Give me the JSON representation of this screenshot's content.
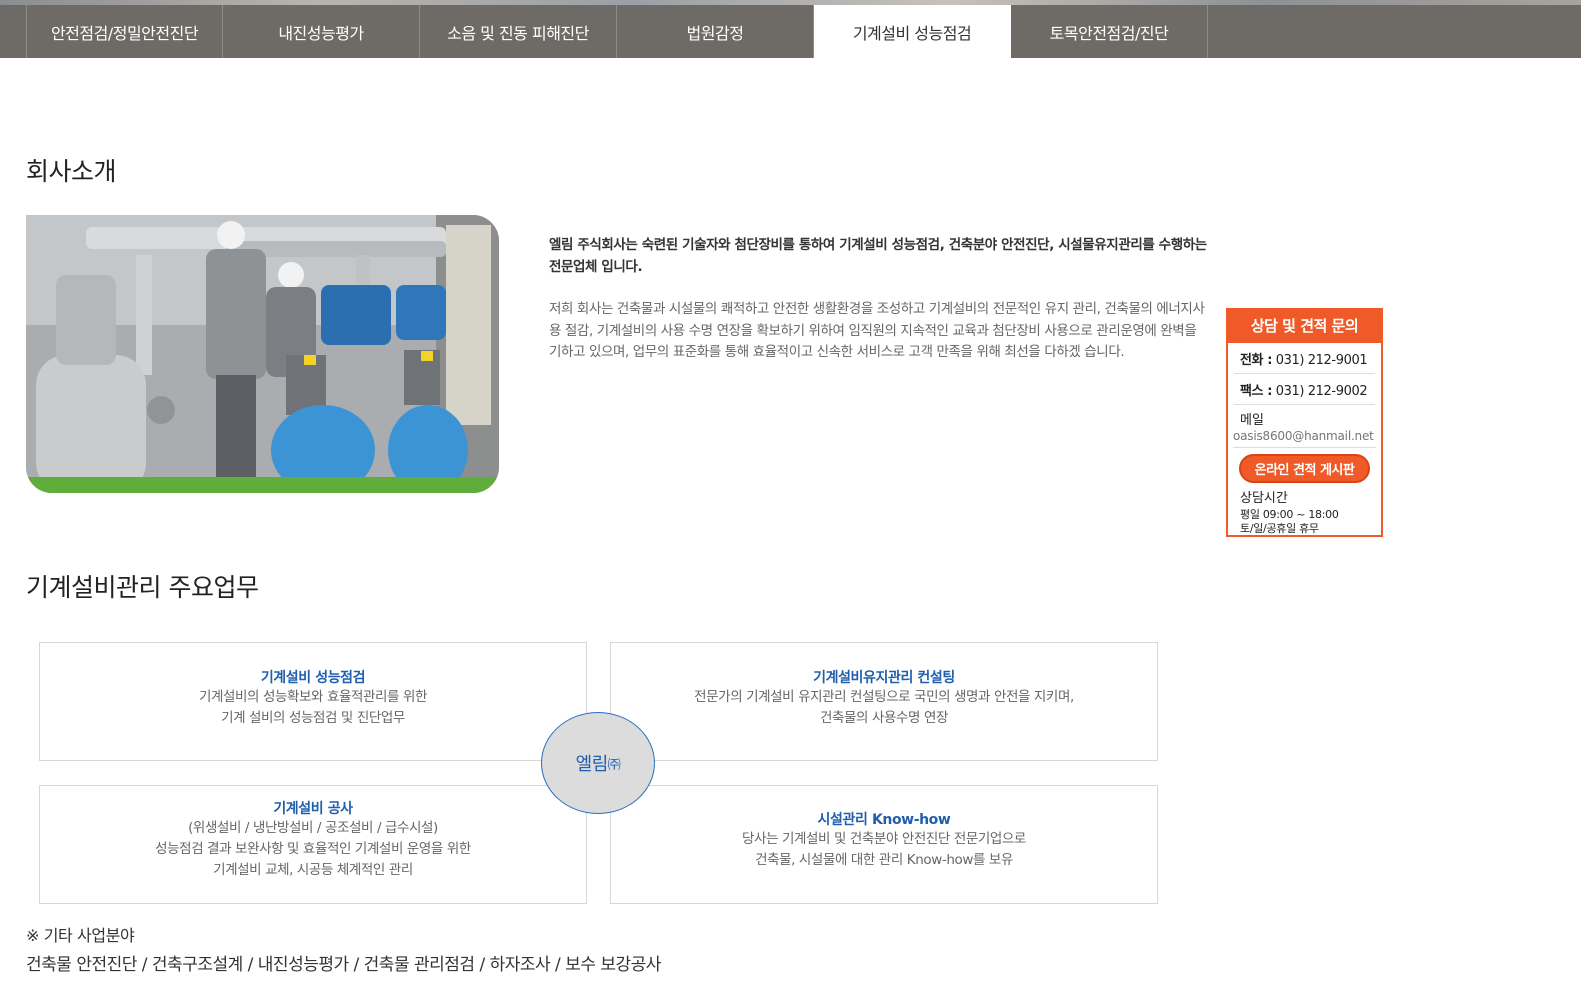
{
  "tabs": [
    {
      "label": "안전점검/정밀안전진단",
      "active": false
    },
    {
      "label": "내진성능평가",
      "active": false
    },
    {
      "label": "소음 및 진동 피해진단",
      "active": false
    },
    {
      "label": "법원감정",
      "active": false
    },
    {
      "label": "기계설비 성능점검",
      "active": true
    },
    {
      "label": "토목안전점검/진단",
      "active": false
    }
  ],
  "company": {
    "title": "회사소개",
    "lead": "엘림 주식회사는 숙련된 기술자와 첨단장비를 통하여 기계설비 성능점검, 건축분야 안전진단, 시설물유지관리를 수행하는 전문업체 입니다.",
    "body": "저희 회사는 건축물과 시설물의 쾌적하고 안전한 생활환경을 조성하고 기계설비의 전문적인 유지 관리, 건축물의 에너지사용 절감, 기계설비의 사용 수명 연장을 확보하기 위하여 임직원의 지속적인 교육과 첨단장비 사용으로 관리운영에 완벽을 기하고 있으며, 업무의 표준화를 통해 효율적이고 신속한 서비스로 고객 만족을 위해 최선을 다하겠 습니다."
  },
  "contact": {
    "title": "상담 및 견적 문의",
    "phone_label": "전화 :",
    "phone": "031) 212-9001",
    "fax_label": "팩스 :",
    "fax": "031) 212-9002",
    "mail_label": "메일",
    "mail": "oasis8600@hanmail.net",
    "button": "온라인 견적 게시판",
    "hours_label": "상담시간",
    "hours_weekday": "평일 09:00 ~ 18:00",
    "hours_off": "토/일/공휴일 휴무"
  },
  "services": {
    "title": "기계설비관리 주요업무",
    "center": "엘림",
    "center_suffix": "㈜",
    "items": [
      {
        "title": "기계설비 성능점검",
        "lines": [
          "기계설비의 성능확보와 효율적관리를 위한",
          "기계 설비의 성능점검 및 진단업무"
        ]
      },
      {
        "title": "기계설비유지관리 컨설팅",
        "lines": [
          "전문가의 기계설비 유지관리 컨설팅으로 국민의 생명과 안전을 지키며,",
          "건축물의 사용수명 연장"
        ]
      },
      {
        "title": "기계설비 공사",
        "lines": [
          "(위생설비 / 냉난방설비 / 공조설비 / 급수시설)",
          "성능점검 결과 보완사항 및 효율적인 기계설비 운영을 위한",
          "기계설비 교체, 시공등 체계적인 관리"
        ]
      },
      {
        "title": "시설관리 Know-how",
        "lines": [
          "당사는 기계설비 및 건축분야 안전진단 전문기업으로",
          "건축물, 시설물에 대한 관리 Know-how를 보유"
        ]
      }
    ]
  },
  "other": {
    "heading": "※ 기타 사업분야",
    "list": "건축물 안전진단 / 건축구조설계 / 내진성능평가 / 건축물 관리점검 / 하자조사 / 보수 보강공사"
  }
}
